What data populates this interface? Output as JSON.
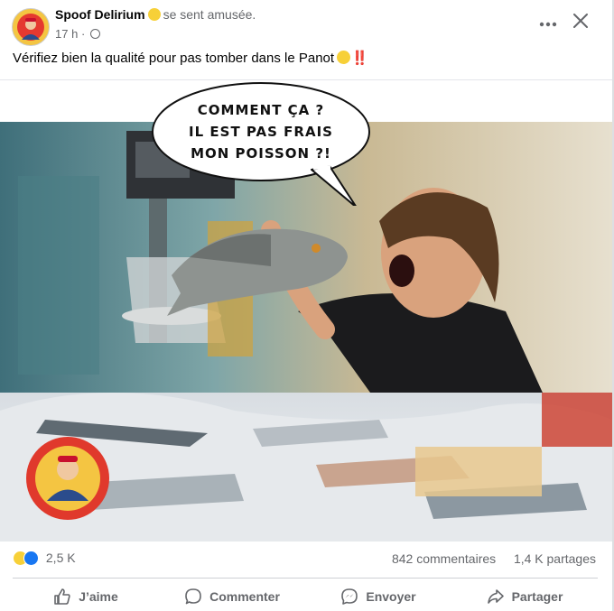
{
  "post": {
    "author": "Spoof Delirium",
    "feeling": "se sent amusée.",
    "time": "17 h",
    "separator": "·",
    "caption": "Vérifiez bien la qualité pour pas tomber dans le Panot",
    "caption_suffix": "‼️",
    "more_icon": "more-horizontal-icon",
    "close_icon": "close-icon"
  },
  "image": {
    "speech_bubble": [
      "COMMENT ÇA ?",
      "IL EST PAS FRAIS",
      "MON POISSON ?!"
    ],
    "description_icon": "fish-market-photo"
  },
  "footer": {
    "reaction_count": "2,5 K",
    "comments": "842 commentaires",
    "shares": "1,4 K partages",
    "actions": {
      "like": "J’aime",
      "comment": "Commenter",
      "send": "Envoyer",
      "share": "Partager"
    }
  },
  "colors": {
    "text": "#050505",
    "secondary": "#65676b",
    "like_blue": "#1877f2",
    "haha_yellow": "#f7d038",
    "divider": "#ced0d4"
  }
}
